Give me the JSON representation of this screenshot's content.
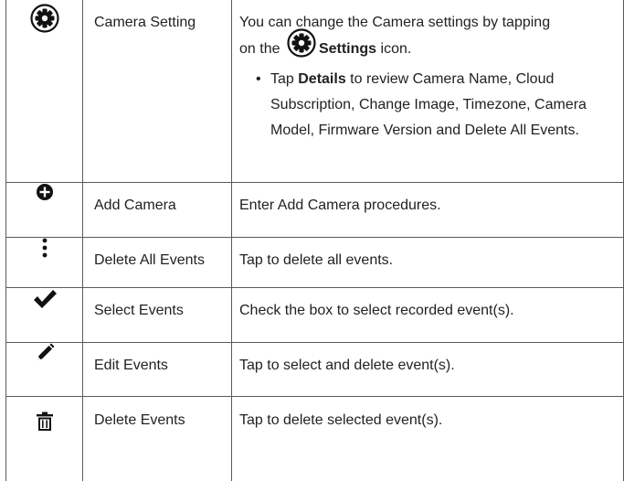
{
  "rows": [
    {
      "icon": "settings-gear-icon",
      "name": "Camera Setting",
      "desc_line1": "You can change the Camera settings by tapping",
      "desc_pre": "on the",
      "desc_bold": "Settings",
      "desc_post": "icon.",
      "bullet_symbol": "•",
      "bullet_pre": "Tap",
      "bullet_bold": "Details",
      "bullet_post": "to review Camera Name, Cloud Subscription, Change Image, Timezone, Camera Model, Firmware Version and Delete All Events."
    },
    {
      "icon": "add-circle-icon",
      "name": "Add Camera",
      "desc": "Enter Add Camera procedures."
    },
    {
      "icon": "more-vertical-icon",
      "name": "Delete All Events",
      "desc": "Tap to delete all events."
    },
    {
      "icon": "checkmark-icon",
      "name": "Select Events",
      "desc": "Check the box to select recorded event(s)."
    },
    {
      "icon": "pencil-icon",
      "name": "Edit Events",
      "desc": "Tap to select and delete event(s)."
    },
    {
      "icon": "trash-icon",
      "name": "Delete Events",
      "desc": "Tap to delete selected event(s)."
    }
  ]
}
